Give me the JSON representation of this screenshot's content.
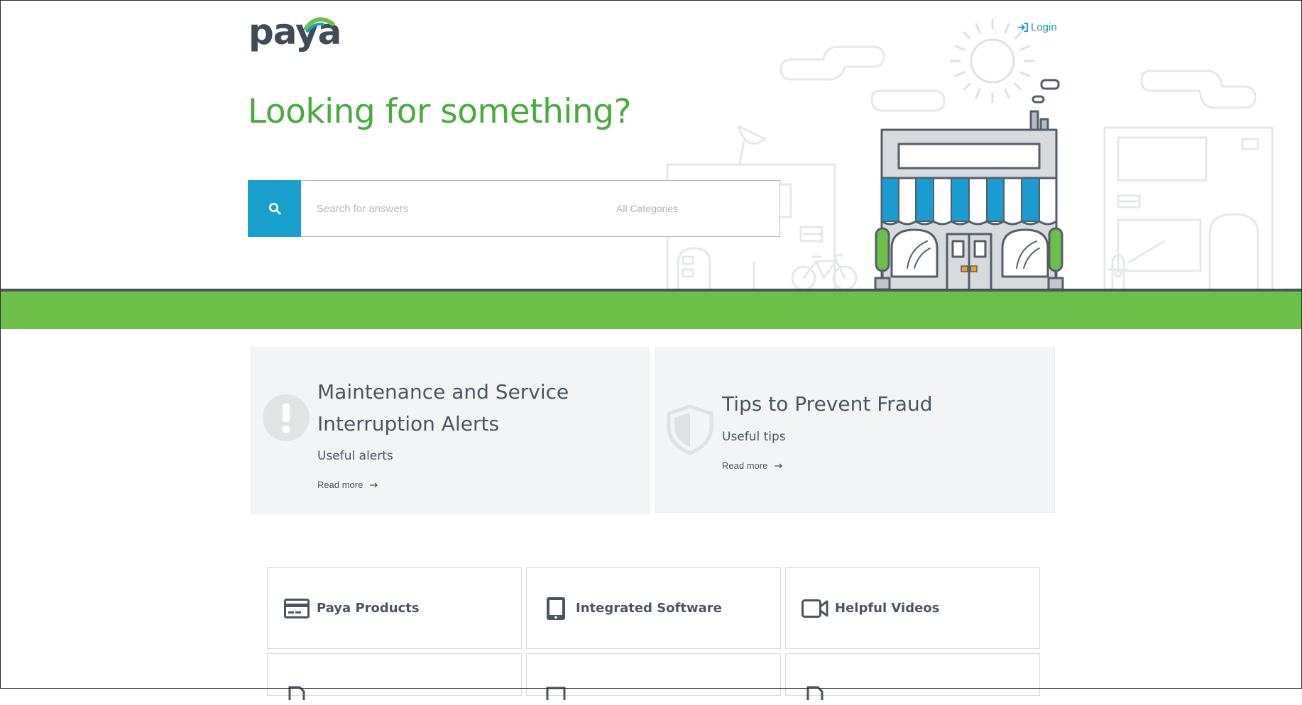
{
  "header": {
    "logo_text": "paya",
    "login_label": "Login"
  },
  "hero": {
    "headline": "Looking for something?",
    "search_placeholder": "Search for answers",
    "category_label": "All Categories"
  },
  "colors": {
    "brand_green": "#6cc04a",
    "headline_green": "#46ac3c",
    "accent_blue": "#1aa0cc",
    "text_dark": "#4a5560"
  },
  "features": [
    {
      "icon": "exclamation-circle-icon",
      "title_line1": "Maintenance and Service",
      "title_line2": "Interruption Alerts",
      "subtitle": "Useful alerts",
      "link": "Read more"
    },
    {
      "icon": "shield-icon",
      "title_line1": "Tips to Prevent Fraud",
      "subtitle": "Useful tips",
      "link": "Read more"
    }
  ],
  "categories": [
    {
      "icon": "credit-card-icon",
      "label": "Paya Products"
    },
    {
      "icon": "tablet-icon",
      "label": "Integrated Software"
    },
    {
      "icon": "video-camera-icon",
      "label": "Helpful Videos"
    }
  ]
}
